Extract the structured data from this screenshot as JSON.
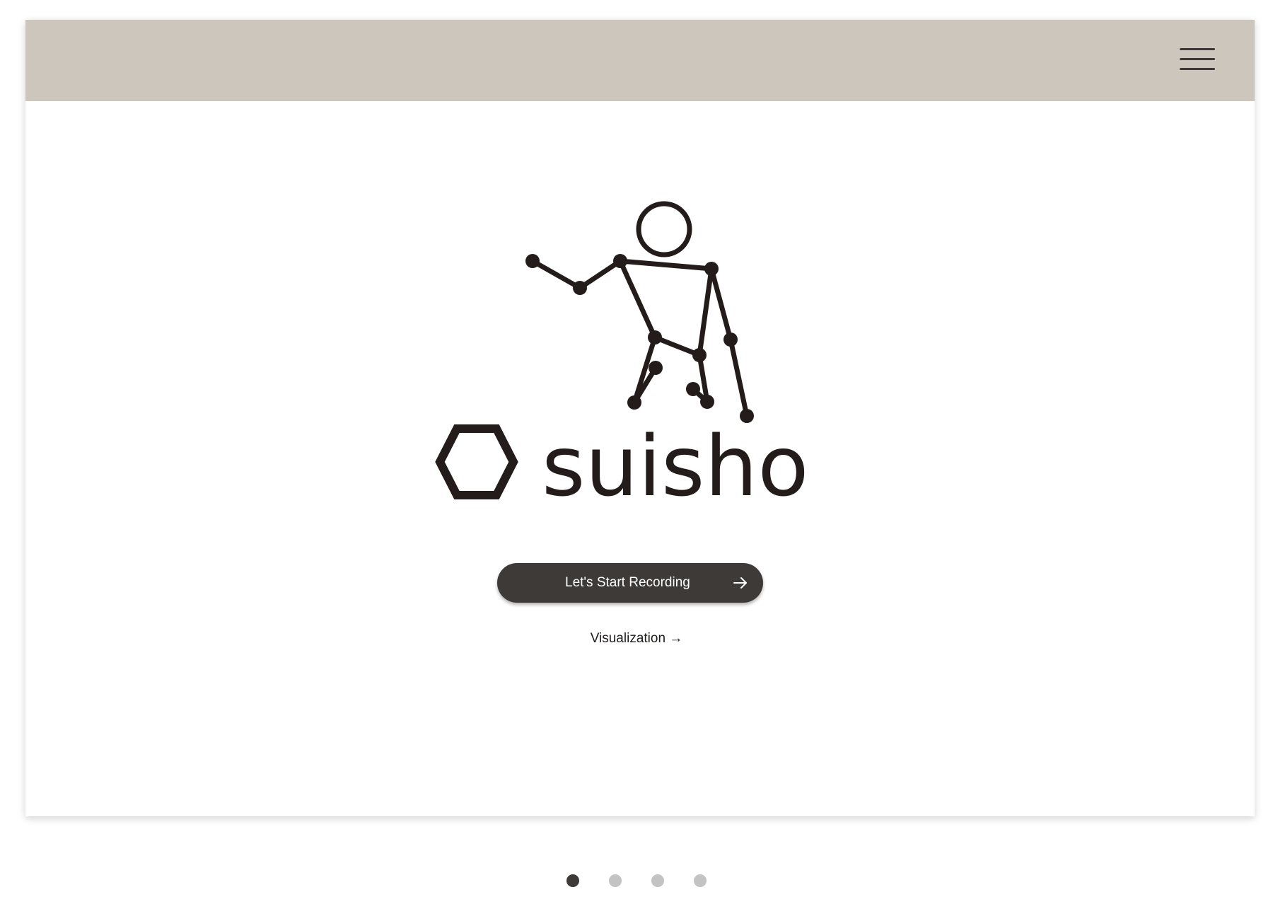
{
  "header": {
    "background_color": "#cdc6bc",
    "menu_icon": "hamburger-menu-icon"
  },
  "hero": {
    "illustration_icon": "stick-figure-skeleton-icon",
    "brand_name": "suisho",
    "brand_color": "#231c1a"
  },
  "actions": {
    "start_recording_label": "Let's Start Recording",
    "start_recording_icon": "arrow-right-icon",
    "visualization_label": "Visualization →"
  },
  "pagination": {
    "total": 4,
    "active_index": 0,
    "active_color": "#3d3a37",
    "inactive_color": "#c3c3c3"
  }
}
